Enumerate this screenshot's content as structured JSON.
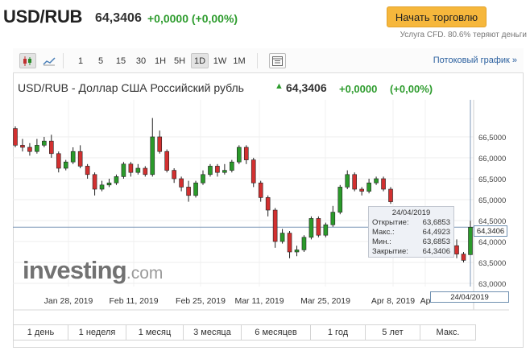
{
  "header": {
    "symbol": "USD/RUB",
    "price": "64,3406",
    "change": "+0,0000 (+0,00%)",
    "trade_button": "Начать торговлю",
    "cfd_note": "Услуга CFD. 80.6% теряют деньги"
  },
  "toolbar": {
    "chart_type_icons": [
      "candlestick-icon",
      "line-chart-icon"
    ],
    "intervals": [
      "1",
      "5",
      "15",
      "30",
      "1H",
      "5H",
      "1D",
      "1W",
      "1M"
    ],
    "active_interval": "1D",
    "settings_icon": "indicators-icon",
    "stream_link": "Потоковый график »"
  },
  "chart_header": {
    "title": "USD/RUB - Доллар США Российский рубль",
    "arrow": "▲",
    "price": "64,3406",
    "change": "+0,0000",
    "change_pct": "(+0,00%)"
  },
  "chart_data": {
    "type": "candlestick",
    "x_tick_labels": [
      "Jan 28, 2019",
      "Feb 11, 2019",
      "Feb 25, 2019",
      "Mar 11, 2019",
      "Mar 25, 2019",
      "Apr 8, 2019",
      "Ap"
    ],
    "y_tick_labels": [
      "66,5000",
      "66,0000",
      "65,5000",
      "65,0000",
      "64,5000",
      "64,0000",
      "63,5000",
      "63,0000"
    ],
    "y_ticks": [
      66.5,
      66.0,
      65.5,
      65.0,
      64.5,
      64.0,
      63.5,
      63.0
    ],
    "ylim": [
      63.0,
      66.9
    ],
    "current_price": 64.3406,
    "current_price_label": "64,3406",
    "up_color": "#2a9a2a",
    "down_color": "#d23030",
    "candles": [
      {
        "o": 66.7,
        "c": 66.3,
        "h": 66.75,
        "l": 66.25
      },
      {
        "o": 66.3,
        "c": 66.25,
        "h": 66.45,
        "l": 66.15
      },
      {
        "o": 66.25,
        "c": 66.15,
        "h": 66.35,
        "l": 66.05
      },
      {
        "o": 66.15,
        "c": 66.3,
        "h": 66.45,
        "l": 66.1
      },
      {
        "o": 66.3,
        "c": 66.4,
        "h": 66.5,
        "l": 66.25
      },
      {
        "o": 66.4,
        "c": 66.1,
        "h": 66.55,
        "l": 66.0
      },
      {
        "o": 66.1,
        "c": 65.75,
        "h": 66.15,
        "l": 65.65
      },
      {
        "o": 65.75,
        "c": 65.9,
        "h": 65.95,
        "l": 65.7
      },
      {
        "o": 65.9,
        "c": 66.15,
        "h": 66.25,
        "l": 65.85
      },
      {
        "o": 66.15,
        "c": 65.8,
        "h": 66.3,
        "l": 65.75
      },
      {
        "o": 65.8,
        "c": 65.6,
        "h": 65.85,
        "l": 65.5
      },
      {
        "o": 65.6,
        "c": 65.25,
        "h": 65.65,
        "l": 65.1
      },
      {
        "o": 65.25,
        "c": 65.35,
        "h": 65.45,
        "l": 65.2
      },
      {
        "o": 65.35,
        "c": 65.4,
        "h": 65.5,
        "l": 65.3
      },
      {
        "o": 65.4,
        "c": 65.55,
        "h": 65.6,
        "l": 65.35
      },
      {
        "o": 65.55,
        "c": 65.85,
        "h": 65.9,
        "l": 65.5
      },
      {
        "o": 65.85,
        "c": 65.65,
        "h": 65.9,
        "l": 65.55
      },
      {
        "o": 65.65,
        "c": 65.75,
        "h": 65.85,
        "l": 65.6
      },
      {
        "o": 65.75,
        "c": 65.6,
        "h": 65.8,
        "l": 65.55
      },
      {
        "o": 65.6,
        "c": 66.5,
        "h": 66.95,
        "l": 65.55
      },
      {
        "o": 66.5,
        "c": 66.15,
        "h": 66.65,
        "l": 66.1
      },
      {
        "o": 66.15,
        "c": 65.7,
        "h": 66.2,
        "l": 65.65
      },
      {
        "o": 65.7,
        "c": 65.5,
        "h": 65.75,
        "l": 65.4
      },
      {
        "o": 65.5,
        "c": 65.3,
        "h": 65.55,
        "l": 65.2
      },
      {
        "o": 65.3,
        "c": 65.1,
        "h": 65.45,
        "l": 64.95
      },
      {
        "o": 65.1,
        "c": 65.4,
        "h": 65.45,
        "l": 65.05
      },
      {
        "o": 65.4,
        "c": 65.6,
        "h": 65.7,
        "l": 65.35
      },
      {
        "o": 65.6,
        "c": 65.8,
        "h": 65.85,
        "l": 65.55
      },
      {
        "o": 65.8,
        "c": 65.65,
        "h": 65.85,
        "l": 65.55
      },
      {
        "o": 65.65,
        "c": 65.7,
        "h": 65.85,
        "l": 65.6
      },
      {
        "o": 65.7,
        "c": 65.9,
        "h": 65.95,
        "l": 65.65
      },
      {
        "o": 65.9,
        "c": 66.25,
        "h": 66.3,
        "l": 65.85
      },
      {
        "o": 66.25,
        "c": 65.95,
        "h": 66.3,
        "l": 65.85
      },
      {
        "o": 65.95,
        "c": 65.4,
        "h": 66.0,
        "l": 65.3
      },
      {
        "o": 65.4,
        "c": 65.05,
        "h": 65.45,
        "l": 64.95
      },
      {
        "o": 65.05,
        "c": 64.75,
        "h": 65.1,
        "l": 64.6
      },
      {
        "o": 64.75,
        "c": 64.0,
        "h": 64.8,
        "l": 63.85
      },
      {
        "o": 64.0,
        "c": 64.2,
        "h": 64.3,
        "l": 63.95
      },
      {
        "o": 64.2,
        "c": 63.75,
        "h": 64.25,
        "l": 63.6
      },
      {
        "o": 63.75,
        "c": 63.8,
        "h": 63.9,
        "l": 63.65
      },
      {
        "o": 63.8,
        "c": 64.1,
        "h": 64.15,
        "l": 63.75
      },
      {
        "o": 64.1,
        "c": 64.55,
        "h": 64.6,
        "l": 64.05
      },
      {
        "o": 64.55,
        "c": 64.15,
        "h": 64.6,
        "l": 64.1
      },
      {
        "o": 64.15,
        "c": 64.4,
        "h": 64.45,
        "l": 64.1
      },
      {
        "o": 64.4,
        "c": 64.7,
        "h": 64.85,
        "l": 64.35
      },
      {
        "o": 64.7,
        "c": 65.3,
        "h": 65.35,
        "l": 64.65
      },
      {
        "o": 65.3,
        "c": 65.6,
        "h": 65.7,
        "l": 65.25
      },
      {
        "o": 65.6,
        "c": 65.25,
        "h": 65.65,
        "l": 65.2
      },
      {
        "o": 65.25,
        "c": 65.2,
        "h": 65.3,
        "l": 65.1
      },
      {
        "o": 65.2,
        "c": 65.4,
        "h": 65.5,
        "l": 65.15
      },
      {
        "o": 65.4,
        "c": 65.5,
        "h": 65.55,
        "l": 65.35
      },
      {
        "o": 65.5,
        "c": 65.25,
        "h": 65.55,
        "l": 65.2
      },
      {
        "o": 65.25,
        "c": 64.95,
        "h": 65.3,
        "l": 64.9
      },
      {
        "o": 63.9,
        "c": 63.7,
        "h": 64.05,
        "l": 63.6
      },
      {
        "o": 63.7,
        "c": 63.55,
        "h": 63.75,
        "l": 63.5
      },
      {
        "o": 63.6853,
        "c": 64.3406,
        "h": 64.4923,
        "l": 63.6853
      }
    ],
    "tooltip": {
      "date": "24/04/2019",
      "rows": [
        {
          "label": "Открытие:",
          "value": "63,6853"
        },
        {
          "label": "Макс.:",
          "value": "64,4923"
        },
        {
          "label": "Мин.:",
          "value": "63,6853"
        },
        {
          "label": "Закрытие:",
          "value": "64,3406"
        }
      ]
    },
    "crosshair_date_label": "24/04/2019"
  },
  "watermark": {
    "brand": "investing",
    "suffix": ".com"
  },
  "periods": [
    "1 день",
    "1 неделя",
    "1 месяц",
    "3 месяца",
    "6 месяцев",
    "1 год",
    "5 лет",
    "Макс."
  ]
}
